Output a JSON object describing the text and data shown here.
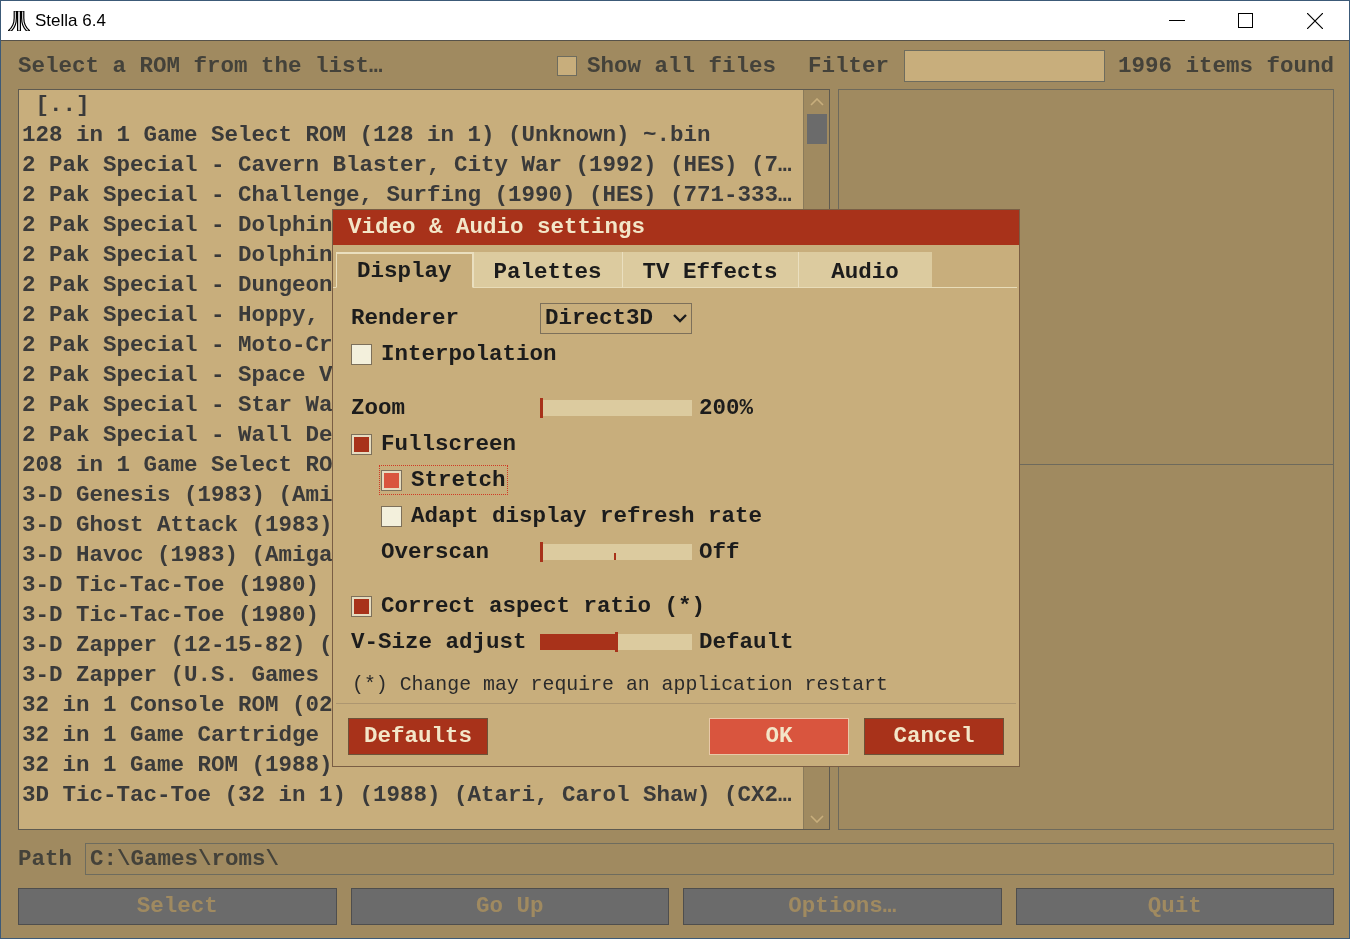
{
  "window": {
    "title": "Stella 6.4"
  },
  "launcher": {
    "disabled": true,
    "prompt": "Select a ROM from the list…",
    "show_all_files": {
      "label": "Show all files",
      "checked": false
    },
    "filter": {
      "label": "Filter"
    },
    "item_count": "1996 items found",
    "rom_list": [
      {
        "kind": "parent",
        "label": "[..]",
        "selected": false
      },
      {
        "kind": "file",
        "label": "128 in 1 Game Select ROM (128 in 1) (Unknown) ~.bin",
        "selected": false
      },
      {
        "kind": "file",
        "label": "2 Pak Special - Cavern Blaster, City War (1992) (HES) (7…",
        "selected": false
      },
      {
        "kind": "file",
        "label": "2 Pak Special - Challenge, Surfing (1990) (HES) (771-333…",
        "selected": false
      },
      {
        "kind": "file",
        "label": "2 Pak Special - Dolphin",
        "selected": false
      },
      {
        "kind": "file",
        "label": "2 Pak Special - Dolphin",
        "selected": false
      },
      {
        "kind": "file",
        "label": "2 Pak Special - Dungeon",
        "selected": false
      },
      {
        "kind": "file",
        "label": "2 Pak Special - Hoppy,",
        "selected": false
      },
      {
        "kind": "file",
        "label": "2 Pak Special - Moto-Cr",
        "selected": false
      },
      {
        "kind": "file",
        "label": "2 Pak Special - Space V",
        "selected": false
      },
      {
        "kind": "file",
        "label": "2 Pak Special - Star Wa",
        "selected": false
      },
      {
        "kind": "file",
        "label": "2 Pak Special - Wall De",
        "selected": false
      },
      {
        "kind": "file",
        "label": "208 in 1 Game Select RO",
        "selected": false
      },
      {
        "kind": "file",
        "label": "3-D Genesis (1983) (Ami",
        "selected": false
      },
      {
        "kind": "file",
        "label": "3-D Ghost Attack (1983)",
        "selected": false
      },
      {
        "kind": "file",
        "label": "3-D Havoc (1983) (Amiga",
        "selected": false
      },
      {
        "kind": "file",
        "label": "3-D Tic-Tac-Toe (1980)",
        "selected": false
      },
      {
        "kind": "file",
        "label": "3-D Tic-Tac-Toe (1980)",
        "selected": false
      },
      {
        "kind": "file",
        "label": "3-D Zapper (12-15-82) (",
        "selected": false
      },
      {
        "kind": "file",
        "label": "3-D Zapper (U.S. Games",
        "selected": false
      },
      {
        "kind": "file",
        "label": "32 in 1 Console ROM (02",
        "selected": false
      },
      {
        "kind": "file",
        "label": "32 in 1 Game Cartridge",
        "selected": false
      },
      {
        "kind": "file",
        "label": "32 in 1 Game ROM (1988)",
        "selected": false
      },
      {
        "kind": "file",
        "label": "3D Tic-Tac-Toe (32 in 1) (1988) (Atari, Carol Shaw) (CX2…",
        "selected": false
      }
    ],
    "path": {
      "label": "Path",
      "value": "C:\\Games\\roms\\"
    },
    "buttons": [
      "Select",
      "Go Up",
      "Options…",
      "Quit"
    ]
  },
  "dialog": {
    "title": "Video & Audio settings",
    "tabs": [
      {
        "label": "Display",
        "selected": true
      },
      {
        "label": "Palettes",
        "selected": false
      },
      {
        "label": "TV Effects",
        "selected": false
      },
      {
        "label": "Audio",
        "selected": false
      }
    ],
    "sections": [
      [
        {
          "kind": "dropdown",
          "label": "Renderer",
          "value": "Direct3D"
        },
        {
          "kind": "checkbox",
          "label": "Interpolation",
          "checked": false,
          "focused": false
        }
      ],
      [
        {
          "kind": "slider",
          "label": "Zoom",
          "level": 0,
          "reading": "200%"
        },
        {
          "kind": "checkbox",
          "label": "Fullscreen",
          "checked": true,
          "focused": false,
          "children": [
            {
              "kind": "checkbox",
              "label": "Stretch",
              "checked": true,
              "focused": true
            },
            {
              "kind": "checkbox",
              "label": "Adapt display refresh rate",
              "checked": false,
              "focused": false
            },
            {
              "kind": "slider",
              "label": "Overscan",
              "level": 0,
              "reading": "Off",
              "center_mark": true
            }
          ]
        }
      ],
      [
        {
          "kind": "checkbox",
          "label": "Correct aspect ratio (*)",
          "checked": true,
          "focused": false
        },
        {
          "kind": "slider",
          "label": "V-Size adjust",
          "level": 0.5,
          "reading": "Default"
        }
      ]
    ],
    "note": "(*) Change may require an application restart",
    "buttons": [
      {
        "label": "Defaults",
        "highlighted": false
      },
      {
        "label": "OK",
        "highlighted": true
      },
      {
        "label": "Cancel",
        "highlighted": false
      }
    ]
  }
}
